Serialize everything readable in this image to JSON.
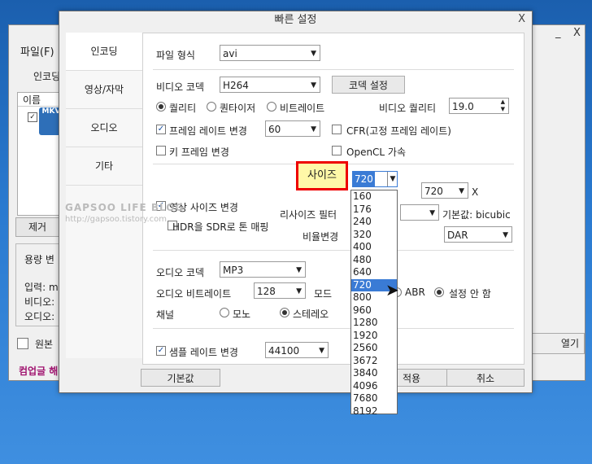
{
  "background_app": {
    "menu_file": "파일(F)",
    "tab_encoding": "인코딩",
    "col_name": "이름",
    "file_badge": "MKV",
    "remove_btn": "제거",
    "capacity_label": "용량 변",
    "input_label": "입력: m",
    "video_label": "비디오:",
    "audio_label": "오디오:",
    "original_label": "원본",
    "open_btn": "열기",
    "status_text": "컴업글 해",
    "minimize": "_",
    "close": "X"
  },
  "dialog": {
    "title": "빠른 설정",
    "close": "X",
    "sidebar": [
      "인코딩",
      "영상/자막",
      "오디오",
      "기타"
    ],
    "file_format_label": "파일 형식",
    "file_format_value": "avi",
    "video_codec_label": "비디오 코덱",
    "video_codec_value": "H264",
    "codec_settings_btn": "코덱 설정",
    "quality_radio": "퀄리티",
    "quantizer_radio": "퀀타이저",
    "bitrate_radio": "비트레이트",
    "video_quality_label": "비디오 퀄리티",
    "video_quality_value": "19.0",
    "framerate_change_label": "프레임 레이트 변경",
    "framerate_value": "60",
    "cfr_label": "CFR(고정 프레임 레이트)",
    "keyframe_label": "키 프레임 변경",
    "opencl_label": "OpenCL 가속",
    "resize_label": "영상 사이즈 변경",
    "size_label": "사이즈",
    "size_value": "720",
    "size_x": "X",
    "size_height_value": "720",
    "resize_filter_label": "리사이즈 필터",
    "default_filter_text": "기본값: bicubic",
    "hdr_label": "HDR을 SDR로 톤 매핑",
    "aspect_label": "비율변경",
    "aspect_value": "DAR",
    "audio_codec_label": "오디오 코덱",
    "audio_codec_value": "MP3",
    "audio_bitrate_label": "오디오 비트레이트",
    "audio_bitrate_value": "128",
    "mode_label": "모드",
    "abr_label": "ABR",
    "no_setting_label": "설정 안 함",
    "channel_label": "채널",
    "mono_label": "모노",
    "stereo_label": "스테레오",
    "sample_rate_label": "샘플 레이트 변경",
    "sample_rate_value": "44100",
    "default_btn": "기본값",
    "apply_btn": "적용",
    "cancel_btn": "취소",
    "size_options": [
      "160",
      "176",
      "240",
      "320",
      "400",
      "480",
      "640",
      "720",
      "800",
      "960",
      "1280",
      "1920",
      "2560",
      "3672",
      "3840",
      "4096",
      "7680",
      "8192"
    ],
    "size_selected": "720"
  },
  "watermark": {
    "line1": "GAPSOO LIFE BLOG",
    "line2": "http://gapsoo.tistory.com"
  }
}
